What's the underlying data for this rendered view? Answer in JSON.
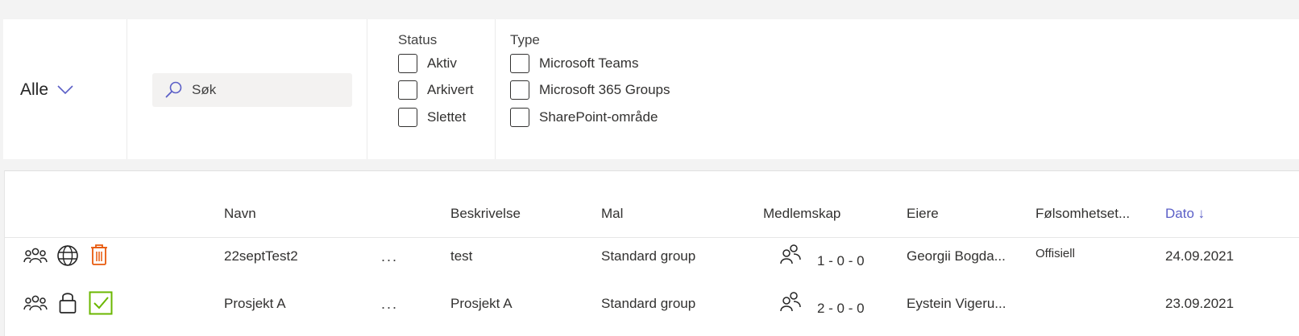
{
  "filters": {
    "scope_label": "Alle",
    "search_placeholder": "Søk",
    "status": {
      "title": "Status",
      "options": [
        "Aktiv",
        "Arkivert",
        "Slettet"
      ]
    },
    "type": {
      "title": "Type",
      "options": [
        "Microsoft Teams",
        "Microsoft 365 Groups",
        "SharePoint-område"
      ]
    }
  },
  "table": {
    "columns": {
      "name": "Navn",
      "description": "Beskrivelse",
      "template": "Mal",
      "membership": "Medlemskap",
      "owners": "Eiere",
      "sensitivity": "Følsomhetset...",
      "date": "Dato ↓"
    },
    "rows": [
      {
        "icons": [
          "teams-icon",
          "globe-icon",
          "trash-icon"
        ],
        "name": "22septTest2",
        "more": "...",
        "description": "test",
        "template": "Standard group",
        "membership": "1 - 0 - 0",
        "owners": "Georgii Bogda...",
        "sensitivity": "Offisiell",
        "date": "24.09.2021"
      },
      {
        "icons": [
          "teams-icon",
          "lock-icon",
          "check-icon"
        ],
        "name": "Prosjekt A",
        "more": "...",
        "description": "Prosjekt A",
        "template": "Standard group",
        "membership": "2 - 0 - 0",
        "owners": "Eystein Vigeru...",
        "sensitivity": "",
        "date": "23.09.2021"
      }
    ]
  },
  "colors": {
    "accent": "#5b5fc7",
    "deleted": "#e8590c",
    "active": "#6bb700"
  }
}
